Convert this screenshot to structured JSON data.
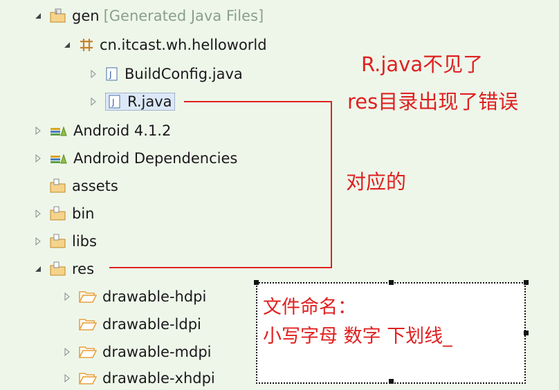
{
  "tree": {
    "gen": {
      "label": "gen",
      "decoration": "[Generated Java Files]"
    },
    "package": {
      "label": "cn.itcast.wh.helloworld"
    },
    "build_config": {
      "label": "BuildConfig.java"
    },
    "r_java": {
      "label": "R.java"
    },
    "android_412": {
      "label": "Android 4.1.2"
    },
    "android_deps": {
      "label": "Android Dependencies"
    },
    "assets": {
      "label": "assets"
    },
    "bin": {
      "label": "bin"
    },
    "libs": {
      "label": "libs"
    },
    "res": {
      "label": "res"
    },
    "drawable_hdpi": {
      "label": "drawable-hdpi"
    },
    "drawable_ldpi": {
      "label": "drawable-ldpi"
    },
    "drawable_mdpi": {
      "label": "drawable-mdpi"
    },
    "drawable_xhdpi": {
      "label": "drawable-xhdpi"
    }
  },
  "annotations": {
    "r_missing": "R.java不见了",
    "res_error": "res目录出现了错误",
    "corresponding": "对应的"
  },
  "note": {
    "line1": "文件命名：",
    "line2": "小写字母  数字  下划线_"
  },
  "colors": {
    "background": "#eef6ea",
    "annotation_red": "#e02020",
    "decoration": "#8aa08a",
    "folder_orange": "#e9a13a",
    "library_icon": "#d9a520"
  }
}
